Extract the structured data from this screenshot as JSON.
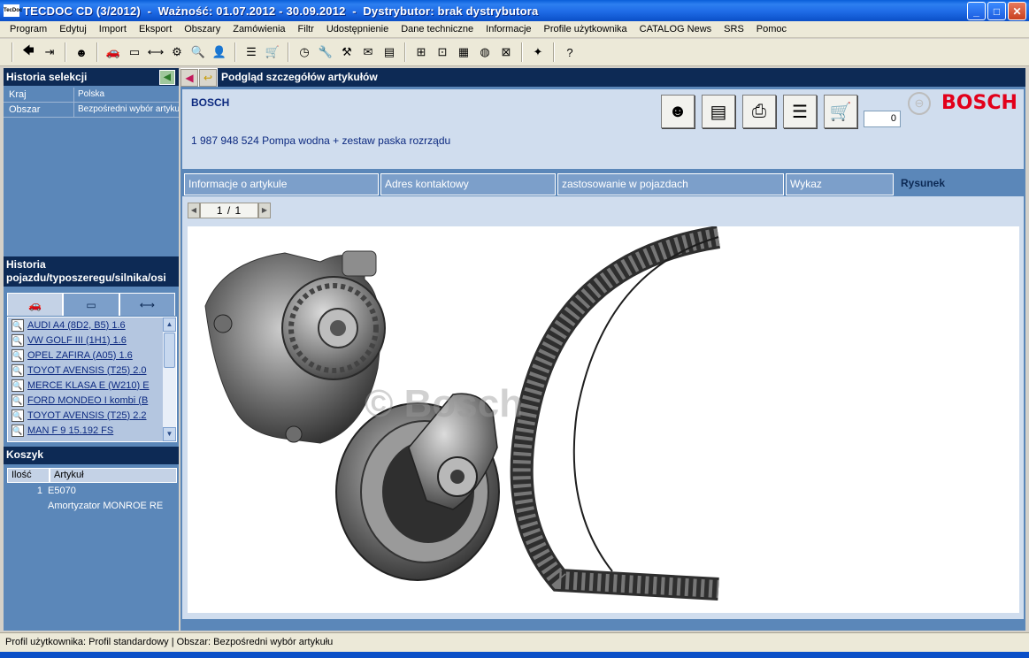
{
  "window": {
    "app_icon_text": "TecDoc",
    "title": "TECDOC CD (3/2012)  -  Ważność: 01.07.2012 - 30.09.2012  -  Dystrybutor: brak dystrybutora",
    "minimize": "_",
    "maximize": "□",
    "close": "✕"
  },
  "menu": [
    "Program",
    "Edytuj",
    "Import",
    "Eksport",
    "Obszary",
    "Zamówienia",
    "Filtr",
    "Udostępnienie",
    "Dane techniczne",
    "Informacje",
    "Profile użytkownika",
    "CATALOG News",
    "SRS",
    "Pomoc"
  ],
  "toolbar": {
    "groups": [
      [
        "back-arrow-icon",
        "exit-icon"
      ],
      [
        "user-icon"
      ],
      [
        "car-icon",
        "axle-icon",
        "truck-axle-icon",
        "engine-icon",
        "search-icon",
        "search-person-icon"
      ],
      [
        "list-icon",
        "cart-icon"
      ],
      [
        "clock-icon",
        "wrench-icon",
        "tools-icon",
        "mail-icon",
        "book-icon"
      ],
      [
        "network-icon",
        "diagram-icon",
        "chart-icon",
        "globe-icon",
        "puzzle-icon"
      ],
      [
        "new-icon"
      ],
      [
        "help-icon"
      ]
    ],
    "glyphs": {
      "back-arrow-icon": "🡄",
      "exit-icon": "⇥",
      "user-icon": "☻",
      "car-icon": "🚗",
      "axle-icon": "▭",
      "truck-axle-icon": "⟷",
      "engine-icon": "⚙",
      "search-icon": "🔍",
      "search-person-icon": "👤",
      "list-icon": "☰",
      "cart-icon": "🛒",
      "clock-icon": "◷",
      "wrench-icon": "🔧",
      "tools-icon": "⚒",
      "mail-icon": "✉",
      "book-icon": "▤",
      "network-icon": "⊞",
      "diagram-icon": "⊡",
      "chart-icon": "▦",
      "globe-icon": "◍",
      "puzzle-icon": "⊠",
      "new-icon": "✦",
      "help-icon": "?"
    }
  },
  "selection_history": {
    "title": "Historia selekcji",
    "rows": [
      {
        "key": "Kraj",
        "value": "Polska"
      },
      {
        "key": "Obszar",
        "value": "Bezpośredni wybór artykułu"
      }
    ]
  },
  "vehicle_history": {
    "title_line1": "Historia",
    "title_line2": "pojazdu/typoszeregu/silnika/osi",
    "tabs": [
      "car-icon",
      "axle-icon",
      "truck-axle-icon"
    ],
    "items": [
      "AUDI A4 (8D2, B5) 1.6",
      "VW GOLF III (1H1) 1.6",
      "OPEL ZAFIRA (A05) 1.6",
      "TOYOT AVENSIS (T25) 2.0",
      "MERCE KLASA E (W210) E",
      "FORD MONDEO I kombi (B",
      "TOYOT AVENSIS (T25) 2.2",
      "MAN F 9 15.192 FS"
    ]
  },
  "cart": {
    "title": "Koszyk",
    "col_qty": "Ilość",
    "col_article": "Artykuł",
    "rows": [
      {
        "qty": "1",
        "article": "E5070",
        "description": "Amortyzator MONROE RE"
      }
    ]
  },
  "article": {
    "header_title": "Podgląd szczegółów artykułów",
    "brand": "BOSCH",
    "description": "1 987 948 524 Pompa wodna + zestaw paska rozrządu",
    "quantity": "0",
    "brand_logo": "BOSCH",
    "watermark": "© Bosch",
    "tabs": [
      "Informacje o artykule",
      "Adres kontaktowy",
      "zastosowanie w pojazdach",
      "Wykaz",
      "Rysunek"
    ],
    "pager": "1  /  1"
  },
  "status": {
    "text": "Profil użytkownika: Profil standardowy | Obszar: Bezpośredni wybór artykułu"
  },
  "colors": {
    "panel_bg": "#5b87b9",
    "header_dark": "#0d2a55",
    "content_light": "#d0ddee",
    "link": "#0d2a80",
    "brand_red": "#e2001a"
  }
}
